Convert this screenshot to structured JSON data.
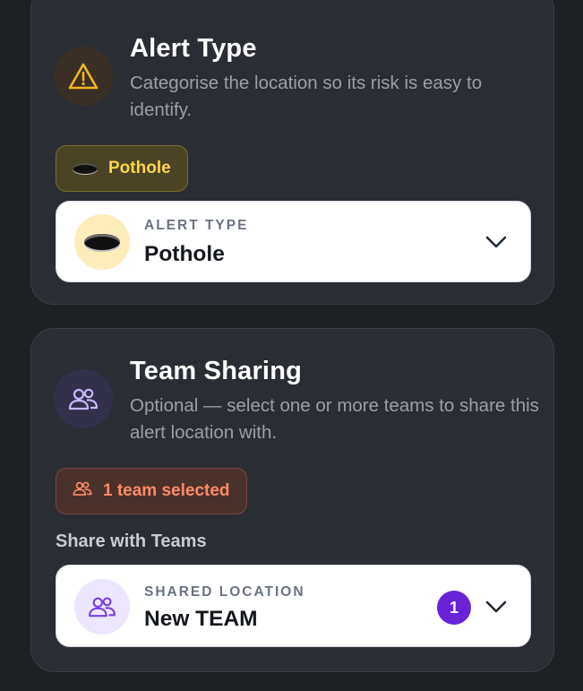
{
  "alert_type_card": {
    "title": "Alert Type",
    "description": "Categorise the location so its risk is easy to identify.",
    "chip_label": "Pothole",
    "select": {
      "label": "ALERT TYPE",
      "value": "Pothole"
    }
  },
  "team_sharing_card": {
    "title": "Team Sharing",
    "description": "Optional — select one or more teams to share this alert location with.",
    "chip_label": "1 team selected",
    "section_label": "Share with Teams",
    "select": {
      "label": "SHARED LOCATION",
      "value": "New TEAM",
      "count": "1"
    }
  },
  "colors": {
    "warning": "#f2b61d",
    "team_chip_text": "#ff8a66",
    "purple": "#6a22d8"
  },
  "icons": {
    "alert_header": "warning-triangle-icon",
    "alert_chip": "pothole-icon",
    "alert_select": "pothole-icon",
    "team_header": "users-icon",
    "team_chip": "users-icon",
    "team_select": "users-icon",
    "dropdown": "chevron-down-icon"
  }
}
